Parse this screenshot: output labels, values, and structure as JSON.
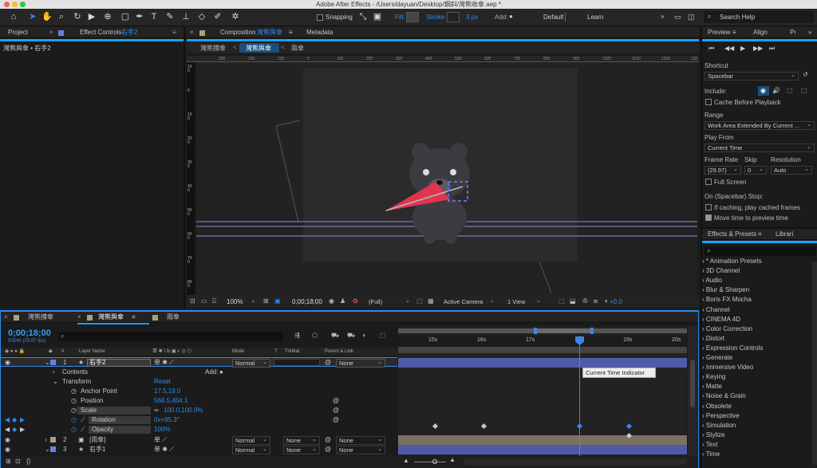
{
  "window": {
    "title": "Adobe After Effects - /Users/dayuan/Desktop/鋼鈄/灣熊收傘.aep *"
  },
  "toolbar": {
    "snapping": "Snapping",
    "fill": "Fill:",
    "stroke": "Stroke:",
    "stroke_width": "3 px",
    "add": "Add:",
    "default": "Default",
    "learn": "Learn",
    "search_placeholder": "Search Help"
  },
  "left_panel": {
    "tab_project": "Project",
    "tab_effect": "Effect Controls",
    "tab_effect_target": "右手2",
    "breadcrumb": "灣熊與傘 • 右手2"
  },
  "comp_panel": {
    "tab_label": "Composition",
    "tab_comp": "灣熊與傘",
    "tab_metadata": "Metadata",
    "crumbs": [
      "灣熊撐傘",
      "灣熊與傘",
      "雨傘"
    ],
    "h_ruler": [
      "300",
      "200",
      "100",
      "0",
      "100",
      "200",
      "300",
      "400",
      "500",
      "600",
      "700",
      "800",
      "900",
      "1000",
      "1100",
      "1200",
      "130"
    ],
    "v_ruler": [
      "100",
      "0",
      "1 0 0",
      "2 0 0",
      "3 0 0",
      "4 0 0",
      "5 0 0",
      "6 0 0",
      "7 0 0",
      "8 0 0"
    ],
    "bottom": {
      "zoom": "100%",
      "timecode": "0;00;18;00",
      "resolution": "(Full)",
      "camera": "Active Camera",
      "view": "1 View",
      "exposure": "+0.0"
    }
  },
  "timeline": {
    "tabs": [
      "灣熊撐傘",
      "灣熊與傘",
      "雨傘"
    ],
    "timecode": "0;00;18;00",
    "frame_info": "00540 (29.97 fps)",
    "search_placeholder": "",
    "col_headers": {
      "num": "#",
      "layer_name": "Layer Name",
      "switches": "单 ✱ \\ fx ▣ ◐ ◎ ⬡",
      "mode": "Mode",
      "t": "T",
      "trkmat": "TrkMat",
      "parent": "Parent & Link"
    },
    "ruler_labels": [
      "15s",
      "16s",
      "17s",
      "19s",
      "20s"
    ],
    "tooltip": "Current Time Indicator",
    "layers": [
      {
        "num": "1",
        "name": "右手2",
        "mode": "Normal",
        "trkmat": "",
        "parent": "None",
        "color": "#6d7fdb"
      },
      {
        "num": "2",
        "name": "[雨傘]",
        "mode": "Normal",
        "trkmat": "None",
        "parent": "None",
        "color": "#b19d7a"
      },
      {
        "num": "3",
        "name": "右手1",
        "mode": "Normal",
        "trkmat": "None",
        "parent": "None",
        "color": "#6d7fdb"
      }
    ],
    "props": {
      "contents": "Contents",
      "add": "Add:",
      "transform": "Transform",
      "reset": "Reset",
      "anchor_label": "Anchor Point",
      "anchor_value": "17.5,19.0",
      "position_label": "Position",
      "position_value": "568.5,464.1",
      "scale_label": "Scale",
      "scale_value": "100.0,100.0%",
      "rotation_label": "Rotation",
      "rotation_value": "0x+85.3°",
      "opacity_label": "Opacity",
      "opacity_value": "100%"
    }
  },
  "right_panel": {
    "tab_preview": "Preview",
    "tab_align": "Align",
    "tab_p": "Pı",
    "shortcut_label": "Shortcut",
    "shortcut_value": "Spacebar",
    "include_label": "Include:",
    "cache_label": "Cache Before Playback",
    "range_label": "Range",
    "range_value": "Work Area Extended By Current ...",
    "playfrom_label": "Play From",
    "playfrom_value": "Current Time",
    "framerate_label": "Frame Rate",
    "skip_label": "Skip",
    "resolution_label": "Resolution",
    "framerate_value": "(29.97)",
    "skip_value": "0",
    "resolution_value": "Auto",
    "fullscreen_label": "Full Screen",
    "stop_label": "On (Spacebar) Stop:",
    "ifcaching_label": "If caching, play cached frames",
    "movetime_label": "Move time to preview time",
    "effects_tab": "Effects & Presets",
    "libraries_tab": "Librari",
    "effects": [
      "* Animation Presets",
      "3D Channel",
      "Audio",
      "Blur & Sharpen",
      "Boris FX Mocha",
      "Channel",
      "CINEMA 4D",
      "Color Correction",
      "Distort",
      "Expression Controls",
      "Generate",
      "Immersive Video",
      "Keying",
      "Matte",
      "Noise & Grain",
      "Obsolete",
      "Perspective",
      "Simulation",
      "Stylize",
      "Text",
      "Time"
    ]
  }
}
